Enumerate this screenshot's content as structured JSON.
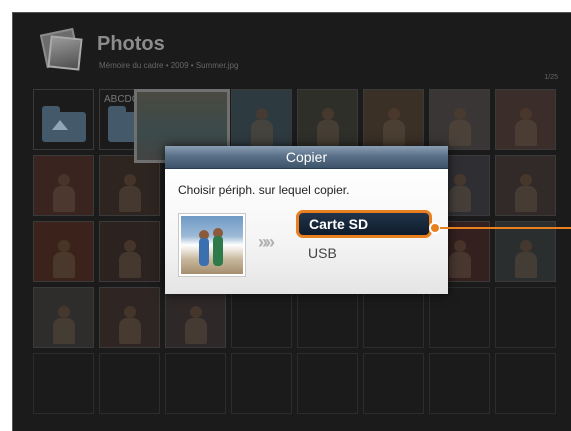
{
  "app": {
    "title": "Photos",
    "breadcrumb": "Mémoire du cadre • 2009 • Summer.jpg",
    "counter": "1/25"
  },
  "grid": {
    "folder_label": "ABCDCI"
  },
  "dialog": {
    "title": "Copier",
    "message": "Choisir périph. sur lequel copier.",
    "options": [
      {
        "label": "Carte SD",
        "selected": true
      },
      {
        "label": "USB",
        "selected": false
      }
    ],
    "arrow_glyph": "»»"
  },
  "colors": {
    "accent": "#e8801f",
    "header": "#3d5369",
    "background": "#1b1b1b"
  },
  "icons": {
    "app": "photos-stack-icon",
    "folder": "folder-up-icon",
    "arrows": "chevrons-right-icon"
  }
}
